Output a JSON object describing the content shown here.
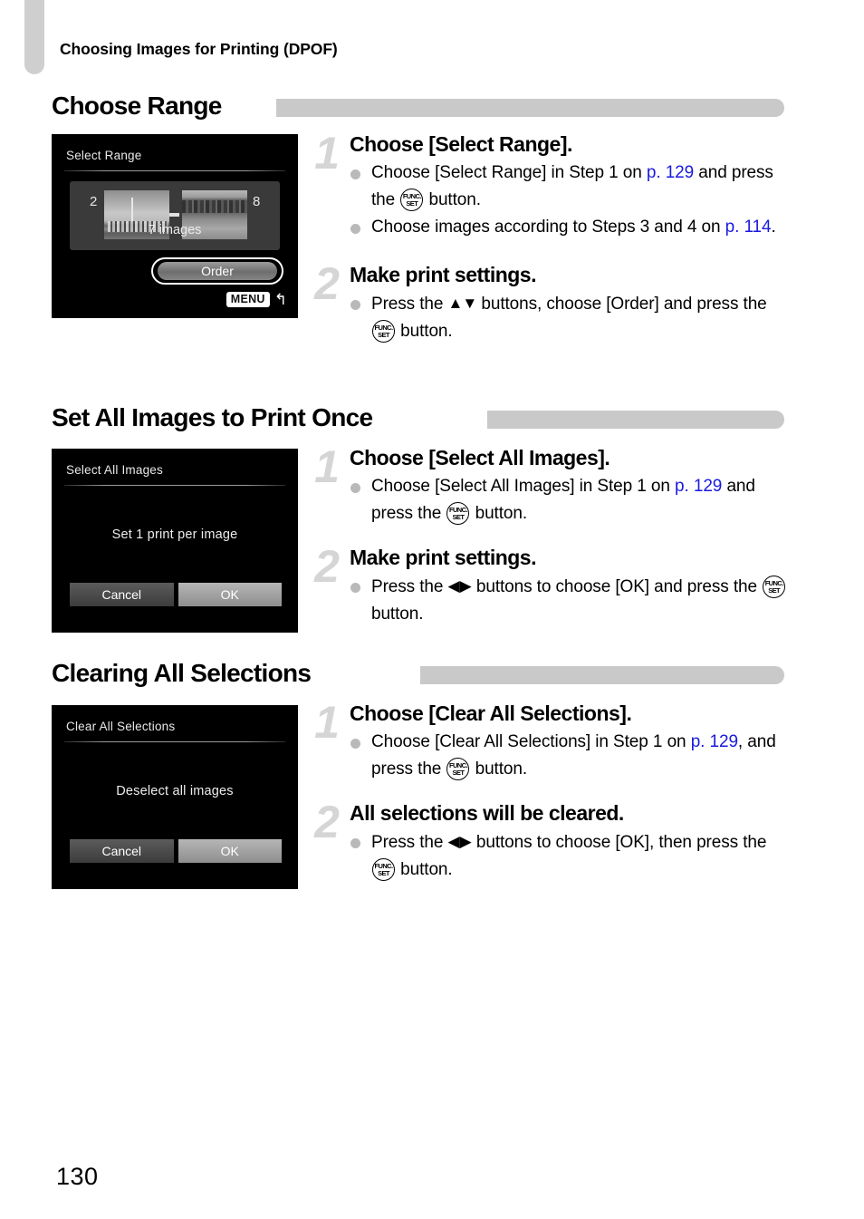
{
  "page": {
    "running_head": "Choosing Images for Printing (DPOF)",
    "page_number": "130",
    "link_color": "#1a1ae0",
    "heading_bar_color": "#c9c9c9",
    "step_number_color": "#d5d5d5"
  },
  "sections": [
    {
      "heading": "Choose Range",
      "screen": {
        "type": "select-range",
        "title": "Select Range",
        "start_index": "2",
        "end_index": "8",
        "count_label": "7 images",
        "order_button": "Order",
        "menu_chip": "MENU"
      },
      "steps": [
        {
          "number": "1",
          "title": "Choose [Select Range].",
          "bullets": [
            {
              "parts": [
                {
                  "t": "text",
                  "v": "Choose [Select Range] in Step 1 on "
                },
                {
                  "t": "link",
                  "v": "p. 129"
                },
                {
                  "t": "text",
                  "v": " and press the "
                },
                {
                  "t": "funcset",
                  "v": "FUNC./SET"
                },
                {
                  "t": "text",
                  "v": " button."
                }
              ]
            },
            {
              "parts": [
                {
                  "t": "text",
                  "v": "Choose images according to Steps 3 and 4 on "
                },
                {
                  "t": "link",
                  "v": "p. 114"
                },
                {
                  "t": "text",
                  "v": "."
                }
              ]
            }
          ]
        },
        {
          "number": "2",
          "title": "Make print settings.",
          "bullets": [
            {
              "parts": [
                {
                  "t": "text",
                  "v": "Press the "
                },
                {
                  "t": "updown",
                  "v": "▲▼"
                },
                {
                  "t": "text",
                  "v": " buttons, choose [Order] and press the "
                },
                {
                  "t": "funcset",
                  "v": "FUNC./SET"
                },
                {
                  "t": "text",
                  "v": " button."
                }
              ]
            }
          ]
        }
      ]
    },
    {
      "heading": "Set All Images to Print Once",
      "screen": {
        "type": "dialog",
        "title": "Select All Images",
        "message": "Set 1 print per image",
        "cancel_label": "Cancel",
        "ok_label": "OK"
      },
      "steps": [
        {
          "number": "1",
          "title": "Choose [Select All Images].",
          "bullets": [
            {
              "parts": [
                {
                  "t": "text",
                  "v": "Choose [Select All Images] in Step 1 on "
                },
                {
                  "t": "link",
                  "v": "p. 129"
                },
                {
                  "t": "text",
                  "v": " and press the "
                },
                {
                  "t": "funcset",
                  "v": "FUNC./SET"
                },
                {
                  "t": "text",
                  "v": " button."
                }
              ]
            }
          ]
        },
        {
          "number": "2",
          "title": "Make print settings.",
          "bullets": [
            {
              "parts": [
                {
                  "t": "text",
                  "v": "Press the "
                },
                {
                  "t": "leftright",
                  "v": "◀▶"
                },
                {
                  "t": "text",
                  "v": " buttons to choose [OK] and press the "
                },
                {
                  "t": "funcset",
                  "v": "FUNC./SET"
                },
                {
                  "t": "text",
                  "v": " button."
                }
              ]
            }
          ]
        }
      ]
    },
    {
      "heading": "Clearing All Selections",
      "screen": {
        "type": "dialog",
        "title": "Clear All Selections",
        "message": "Deselect all images",
        "cancel_label": "Cancel",
        "ok_label": "OK"
      },
      "steps": [
        {
          "number": "1",
          "title": "Choose [Clear All Selections].",
          "bullets": [
            {
              "parts": [
                {
                  "t": "text",
                  "v": "Choose [Clear All Selections] in Step 1 on "
                },
                {
                  "t": "link",
                  "v": "p. 129"
                },
                {
                  "t": "text",
                  "v": ", and press the "
                },
                {
                  "t": "funcset",
                  "v": "FUNC./SET"
                },
                {
                  "t": "text",
                  "v": " button."
                }
              ]
            }
          ]
        },
        {
          "number": "2",
          "title": "All selections will be cleared.",
          "bullets": [
            {
              "parts": [
                {
                  "t": "text",
                  "v": "Press the "
                },
                {
                  "t": "leftright",
                  "v": "◀▶"
                },
                {
                  "t": "text",
                  "v": " buttons to choose [OK], then press the "
                },
                {
                  "t": "funcset",
                  "v": "FUNC./SET"
                },
                {
                  "t": "text",
                  "v": " button."
                }
              ]
            }
          ]
        }
      ]
    }
  ],
  "icons": {
    "funcset_top": "FUNC.",
    "funcset_bottom": "SET",
    "menu_back": "↰"
  }
}
